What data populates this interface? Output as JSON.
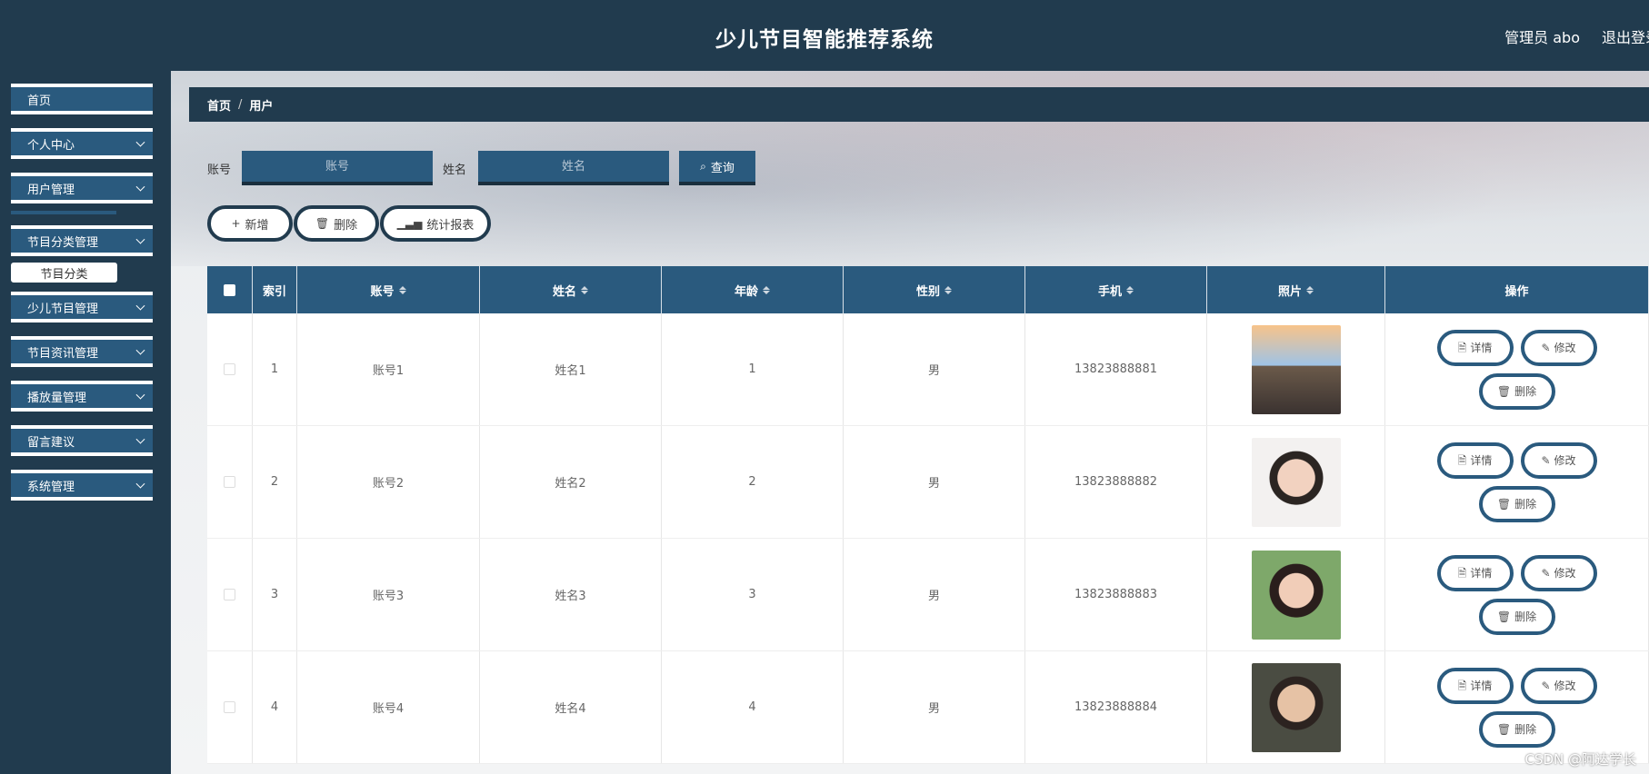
{
  "header": {
    "title": "少儿节目智能推荐系统",
    "user": "管理员 abo",
    "logout": "退出登录"
  },
  "sidebar": {
    "items": [
      {
        "label": "首页"
      },
      {
        "label": "个人中心"
      },
      {
        "label": "用户管理"
      },
      {
        "label": "节目分类管理"
      },
      {
        "label": "少儿节目管理"
      },
      {
        "label": "节目资讯管理"
      },
      {
        "label": "播放量管理"
      },
      {
        "label": "留言建议"
      },
      {
        "label": "系统管理"
      }
    ],
    "submenu_label": "节目分类"
  },
  "breadcrumb": {
    "home": "首页",
    "current": "用户"
  },
  "search": {
    "account_label": "账号",
    "account_placeholder": "账号",
    "name_label": "姓名",
    "name_placeholder": "姓名",
    "query_label": "查询"
  },
  "toolbar": {
    "add": "新增",
    "delete": "删除",
    "report": "统计报表"
  },
  "table": {
    "columns": [
      "索引",
      "账号",
      "姓名",
      "年龄",
      "性别",
      "手机",
      "照片",
      "操作"
    ],
    "rows": [
      {
        "index": "1",
        "account": "账号1",
        "name": "姓名1",
        "age": "1",
        "gender": "男",
        "phone": "13823888881"
      },
      {
        "index": "2",
        "account": "账号2",
        "name": "姓名2",
        "age": "2",
        "gender": "男",
        "phone": "13823888882"
      },
      {
        "index": "3",
        "account": "账号3",
        "name": "姓名3",
        "age": "3",
        "gender": "男",
        "phone": "13823888883"
      },
      {
        "index": "4",
        "account": "账号4",
        "name": "姓名4",
        "age": "4",
        "gender": "男",
        "phone": "13823888884"
      }
    ],
    "actions": {
      "detail": "详情",
      "edit": "修改",
      "delete": "删除"
    }
  },
  "watermark": "CSDN @阿达学长",
  "colors": {
    "navy": "#213b4e",
    "blue": "#2a5a7e"
  }
}
